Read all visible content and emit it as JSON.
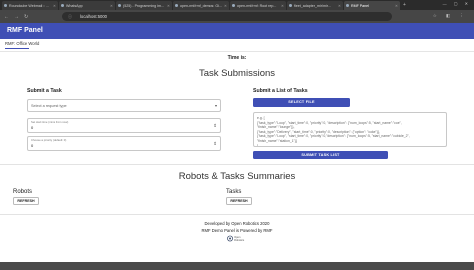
{
  "browser": {
    "tabs": [
      {
        "label": "Roundcube Webmail :: ...",
        "active": false
      },
      {
        "label": "WhatsApp",
        "active": false
      },
      {
        "label": "(525) - Programming im...",
        "active": false
      },
      {
        "label": "open-rmf/rmf_demos: Gi...",
        "active": false
      },
      {
        "label": "open-rmf/rmf: Root rep...",
        "active": false
      },
      {
        "label": "fleet_adapter_mir/mir...",
        "active": false
      },
      {
        "label": "RMF Panel",
        "active": true
      }
    ],
    "url": "localhost:5000",
    "url_info_icon": "info-icon"
  },
  "app": {
    "title": "RMF Panel",
    "subtab": "RMF: Office World",
    "time_label": "Time is:"
  },
  "task_submissions": {
    "title": "Task Submissions",
    "submit_task": {
      "heading": "Submit a Task",
      "request_type_placeholder": "Select a request type",
      "start_time_label": "Set start time (mins from now)",
      "start_time_value": "0",
      "priority_label": "Choose a priority (default: 0)",
      "priority_value": "0"
    },
    "submit_list": {
      "heading": "Submit a List of Tasks",
      "select_file_label": "SELECT FILE",
      "preview_text": "e.g. [\n{\"task_type\":\"Loop\", \"start_time\":0, \"priority\":0, \"description\": {\"num_loops\":5, \"start_name\":\"coe\",\n\"finish_name\":\"lounge\"}},\n{\"task_type\":\"Delivery\", \"start_time\":0, \"priority\":0, \"description\": {\"option\": \"coke\"}},\n{\"task_type\":\"Loop\", \"start_time\":0, \"priority\":0,\"description\": {\"num_loops\":5, \"start_name\":\"cubicle_2\",\n\"finish_name\":\"station_1\"}}\n]",
      "submit_label": "SUBMIT TASK LIST"
    }
  },
  "summaries": {
    "title": "Robots & Tasks Summaries",
    "robots": {
      "heading": "Robots",
      "refresh_label": "REFRESH"
    },
    "tasks": {
      "heading": "Tasks",
      "refresh_label": "REFRESH"
    }
  },
  "footer": {
    "line1": "Developed by Open Robotics 2020",
    "line2": "RMF Demo Panel is Powered by RMF",
    "logo_text": "Open Robotics"
  },
  "colors": {
    "primary": "#3f4fb5",
    "tabbar": "#2b2b2b",
    "toolbar": "#464646"
  }
}
